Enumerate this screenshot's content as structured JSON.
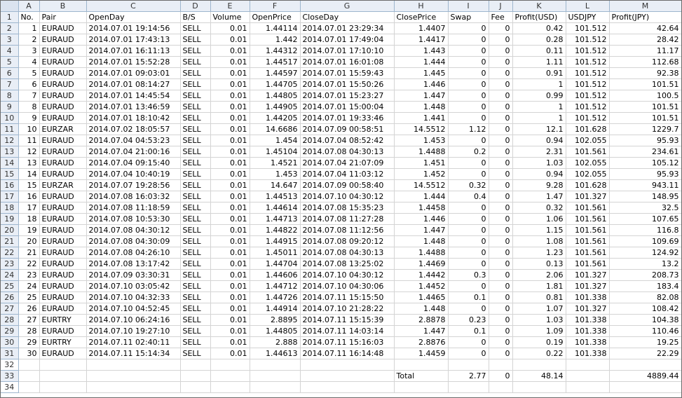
{
  "columns": [
    "A",
    "B",
    "C",
    "D",
    "E",
    "F",
    "G",
    "H",
    "I",
    "J",
    "K",
    "L",
    "M"
  ],
  "header": [
    "No.",
    "Pair",
    "OpenDay",
    "B/S",
    "Volume",
    "OpenPrice",
    "CloseDay",
    "ClosePrice",
    "Swap",
    "Fee",
    "Profit(USD)",
    "USDJPY",
    "Profit(JPY)"
  ],
  "rows": [
    [
      "1",
      "EURAUD",
      "2014.07.01 19:14:56",
      "SELL",
      "0.01",
      "1.44114",
      "2014.07.01 23:29:34",
      "1.4407",
      "0",
      "0",
      "0.42",
      "101.512",
      "42.64"
    ],
    [
      "2",
      "EURAUD",
      "2014.07.01 17:43:13",
      "SELL",
      "0.01",
      "1.442",
      "2014.07.01 17:49:04",
      "1.4417",
      "0",
      "0",
      "0.28",
      "101.512",
      "28.42"
    ],
    [
      "3",
      "EURAUD",
      "2014.07.01 16:11:13",
      "SELL",
      "0.01",
      "1.44312",
      "2014.07.01 17:10:10",
      "1.443",
      "0",
      "0",
      "0.11",
      "101.512",
      "11.17"
    ],
    [
      "4",
      "EURAUD",
      "2014.07.01 15:52:28",
      "SELL",
      "0.01",
      "1.44517",
      "2014.07.01 16:01:08",
      "1.444",
      "0",
      "0",
      "1.11",
      "101.512",
      "112.68"
    ],
    [
      "5",
      "EURAUD",
      "2014.07.01 09:03:01",
      "SELL",
      "0.01",
      "1.44597",
      "2014.07.01 15:59:43",
      "1.445",
      "0",
      "0",
      "0.91",
      "101.512",
      "92.38"
    ],
    [
      "6",
      "EURAUD",
      "2014.07.01 08:14:27",
      "SELL",
      "0.01",
      "1.44705",
      "2014.07.01 15:50:26",
      "1.446",
      "0",
      "0",
      "1",
      "101.512",
      "101.51"
    ],
    [
      "7",
      "EURAUD",
      "2014.07.01 14:45:54",
      "SELL",
      "0.01",
      "1.44805",
      "2014.07.01 15:23:27",
      "1.447",
      "0",
      "0",
      "0.99",
      "101.512",
      "100.5"
    ],
    [
      "8",
      "EURAUD",
      "2014.07.01 13:46:59",
      "SELL",
      "0.01",
      "1.44905",
      "2014.07.01 15:00:04",
      "1.448",
      "0",
      "0",
      "1",
      "101.512",
      "101.51"
    ],
    [
      "9",
      "EURAUD",
      "2014.07.01 18:10:42",
      "SELL",
      "0.01",
      "1.44205",
      "2014.07.01 19:33:46",
      "1.441",
      "0",
      "0",
      "1",
      "101.512",
      "101.51"
    ],
    [
      "10",
      "EURZAR",
      "2014.07.02 18:05:57",
      "SELL",
      "0.01",
      "14.6686",
      "2014.07.09 00:58:51",
      "14.5512",
      "1.12",
      "0",
      "12.1",
      "101.628",
      "1229.7"
    ],
    [
      "11",
      "EURAUD",
      "2014.07.04 04:53:23",
      "SELL",
      "0.01",
      "1.454",
      "2014.07.04 08:52:42",
      "1.453",
      "0",
      "0",
      "0.94",
      "102.055",
      "95.93"
    ],
    [
      "12",
      "EURAUD",
      "2014.07.04 21:00:16",
      "SELL",
      "0.01",
      "1.45104",
      "2014.07.08 04:30:13",
      "1.4488",
      "0.2",
      "0",
      "2.31",
      "101.561",
      "234.61"
    ],
    [
      "13",
      "EURAUD",
      "2014.07.04 09:15:40",
      "SELL",
      "0.01",
      "1.4521",
      "2014.07.04 21:07:09",
      "1.451",
      "0",
      "0",
      "1.03",
      "102.055",
      "105.12"
    ],
    [
      "14",
      "EURAUD",
      "2014.07.04 10:40:19",
      "SELL",
      "0.01",
      "1.453",
      "2014.07.04 11:03:12",
      "1.452",
      "0",
      "0",
      "0.94",
      "102.055",
      "95.93"
    ],
    [
      "15",
      "EURZAR",
      "2014.07.07 19:28:56",
      "SELL",
      "0.01",
      "14.647",
      "2014.07.09 00:58:40",
      "14.5512",
      "0.32",
      "0",
      "9.28",
      "101.628",
      "943.11"
    ],
    [
      "16",
      "EURAUD",
      "2014.07.08 16:03:32",
      "SELL",
      "0.01",
      "1.44513",
      "2014.07.10 04:30:12",
      "1.444",
      "0.4",
      "0",
      "1.47",
      "101.327",
      "148.95"
    ],
    [
      "17",
      "EURAUD",
      "2014.07.08 11:18:59",
      "SELL",
      "0.01",
      "1.44614",
      "2014.07.08 15:35:23",
      "1.4458",
      "0",
      "0",
      "0.32",
      "101.561",
      "32.5"
    ],
    [
      "18",
      "EURAUD",
      "2014.07.08 10:53:30",
      "SELL",
      "0.01",
      "1.44713",
      "2014.07.08 11:27:28",
      "1.446",
      "0",
      "0",
      "1.06",
      "101.561",
      "107.65"
    ],
    [
      "19",
      "EURAUD",
      "2014.07.08 04:30:12",
      "SELL",
      "0.01",
      "1.44822",
      "2014.07.08 11:12:56",
      "1.447",
      "0",
      "0",
      "1.15",
      "101.561",
      "116.8"
    ],
    [
      "20",
      "EURAUD",
      "2014.07.08 04:30:09",
      "SELL",
      "0.01",
      "1.44915",
      "2014.07.08 09:20:12",
      "1.448",
      "0",
      "0",
      "1.08",
      "101.561",
      "109.69"
    ],
    [
      "21",
      "EURAUD",
      "2014.07.08 04:26:10",
      "SELL",
      "0.01",
      "1.45011",
      "2014.07.08 04:30:13",
      "1.4488",
      "0",
      "0",
      "1.23",
      "101.561",
      "124.92"
    ],
    [
      "22",
      "EURAUD",
      "2014.07.08 13:17:42",
      "SELL",
      "0.01",
      "1.44704",
      "2014.07.08 13:25:02",
      "1.4469",
      "0",
      "0",
      "0.13",
      "101.561",
      "13.2"
    ],
    [
      "23",
      "EURAUD",
      "2014.07.09 03:30:31",
      "SELL",
      "0.01",
      "1.44606",
      "2014.07.10 04:30:12",
      "1.4442",
      "0.3",
      "0",
      "2.06",
      "101.327",
      "208.73"
    ],
    [
      "24",
      "EURAUD",
      "2014.07.10 03:05:42",
      "SELL",
      "0.01",
      "1.44712",
      "2014.07.10 04:30:06",
      "1.4452",
      "0",
      "0",
      "1.81",
      "101.327",
      "183.4"
    ],
    [
      "25",
      "EURAUD",
      "2014.07.10 04:32:33",
      "SELL",
      "0.01",
      "1.44726",
      "2014.07.11 15:15:50",
      "1.4465",
      "0.1",
      "0",
      "0.81",
      "101.338",
      "82.08"
    ],
    [
      "26",
      "EURAUD",
      "2014.07.10 04:52:45",
      "SELL",
      "0.01",
      "1.44914",
      "2014.07.10 21:28:22",
      "1.448",
      "0",
      "0",
      "1.07",
      "101.327",
      "108.42"
    ],
    [
      "27",
      "EURTRY",
      "2014.07.10 06:24:16",
      "SELL",
      "0.01",
      "2.8895",
      "2014.07.11 15:15:39",
      "2.8878",
      "0.23",
      "0",
      "1.03",
      "101.338",
      "104.38"
    ],
    [
      "28",
      "EURAUD",
      "2014.07.10 19:27:10",
      "SELL",
      "0.01",
      "1.44805",
      "2014.07.11 14:03:14",
      "1.447",
      "0.1",
      "0",
      "1.09",
      "101.338",
      "110.46"
    ],
    [
      "29",
      "EURTRY",
      "2014.07.11 02:40:11",
      "SELL",
      "0.01",
      "2.888",
      "2014.07.11 15:16:03",
      "2.8876",
      "0",
      "0",
      "0.19",
      "101.338",
      "19.25"
    ],
    [
      "30",
      "EURAUD",
      "2014.07.11 15:14:34",
      "SELL",
      "0.01",
      "1.44613",
      "2014.07.11 16:14:48",
      "1.4459",
      "0",
      "0",
      "0.22",
      "101.338",
      "22.29"
    ]
  ],
  "totals": {
    "label": "Total",
    "swap": "2.77",
    "fee": "0",
    "profit_usd": "48.14",
    "profit_jpy": "4889.44"
  },
  "row_numbers": [
    "1",
    "2",
    "3",
    "4",
    "5",
    "6",
    "7",
    "8",
    "9",
    "10",
    "11",
    "12",
    "13",
    "14",
    "15",
    "16",
    "17",
    "18",
    "19",
    "20",
    "21",
    "22",
    "23",
    "24",
    "25",
    "26",
    "27",
    "28",
    "29",
    "30",
    "31",
    "32",
    "33",
    "34"
  ]
}
